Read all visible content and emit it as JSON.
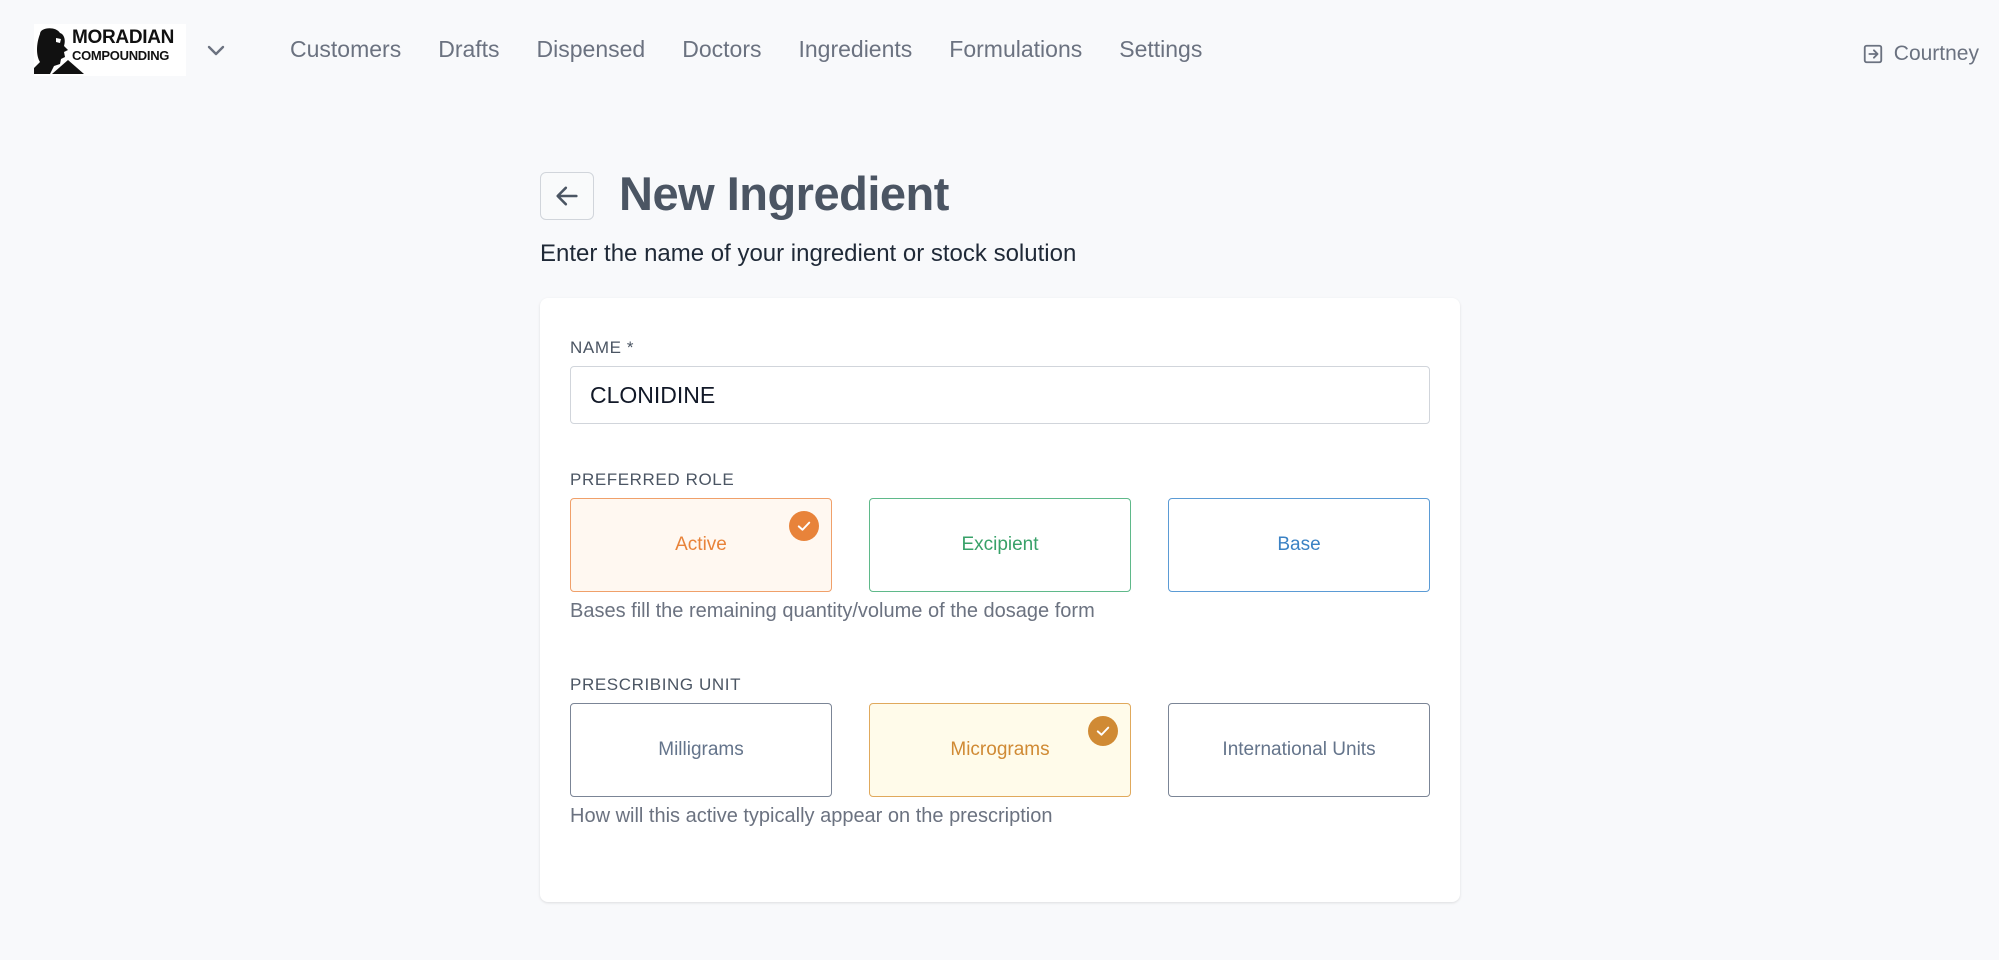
{
  "brand": {
    "name_line1": "MORADIAN",
    "name_line2": "COMPOUNDING",
    "logo_icon": "moradian-logo-icon",
    "menu_icon": "chevron-down-icon"
  },
  "nav": {
    "items": [
      {
        "label": "Customers"
      },
      {
        "label": "Drafts"
      },
      {
        "label": "Dispensed"
      },
      {
        "label": "Doctors"
      },
      {
        "label": "Ingredients"
      },
      {
        "label": "Formulations"
      },
      {
        "label": "Settings"
      }
    ]
  },
  "user": {
    "name": "Courtney",
    "icon": "logout-icon"
  },
  "header": {
    "back_icon": "arrow-left-icon",
    "title": "New Ingredient",
    "subtitle": "Enter the name of your ingredient or stock solution"
  },
  "form": {
    "name": {
      "label": "NAME *",
      "value": "CLONIDINE"
    },
    "preferred_role": {
      "label": "PREFERRED ROLE",
      "options": [
        {
          "label": "Active",
          "selected": true,
          "color": "#e8833a"
        },
        {
          "label": "Excipient",
          "selected": false,
          "color": "#38a169"
        },
        {
          "label": "Base",
          "selected": false,
          "color": "#3b82c4"
        }
      ],
      "help": "Bases fill the remaining quantity/volume of the dosage form"
    },
    "prescribing_unit": {
      "label": "PRESCRIBING UNIT",
      "options": [
        {
          "label": "Milligrams",
          "selected": false,
          "color": "#64748b"
        },
        {
          "label": "Micrograms",
          "selected": true,
          "color": "#d08a34"
        },
        {
          "label": "International Units",
          "selected": false,
          "color": "#64748b"
        }
      ],
      "help": "How will this active typically appear on the prescription"
    }
  },
  "colors": {
    "page_bg": "#f8f9fb",
    "active_fill": "#fff8f1",
    "micrograms_fill": "#fffbea",
    "check_active": "#e8833a",
    "check_micrograms": "#d08a34"
  }
}
